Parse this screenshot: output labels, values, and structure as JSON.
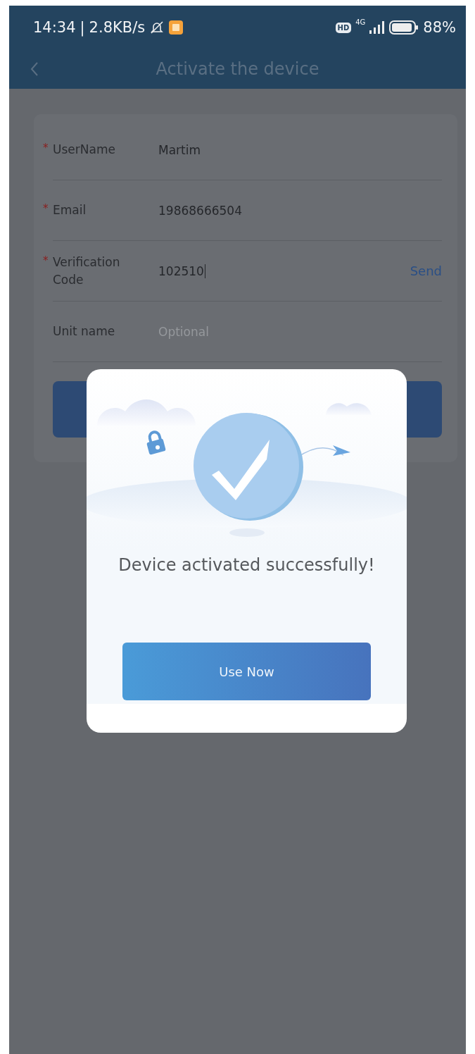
{
  "status_bar": {
    "time": "14:34",
    "separator": "|",
    "speed": "2.8KB/s",
    "hd": "HD",
    "network": "4G",
    "battery": "88%"
  },
  "header": {
    "title": "Activate the device"
  },
  "form": {
    "required_mark": "*",
    "fields": [
      {
        "label": "UserName",
        "required": true,
        "value": "Martim",
        "focused": false
      },
      {
        "label": "Email",
        "required": true,
        "value": "19868666504",
        "focused": false
      },
      {
        "label": "Verification Code",
        "required": true,
        "value": "102510",
        "focused": true,
        "action": "Send"
      },
      {
        "label": "Unit name",
        "required": false,
        "placeholder": "Optional",
        "focused": false
      }
    ]
  },
  "dialog": {
    "message": "Device activated successfully!",
    "button": "Use Now"
  }
}
